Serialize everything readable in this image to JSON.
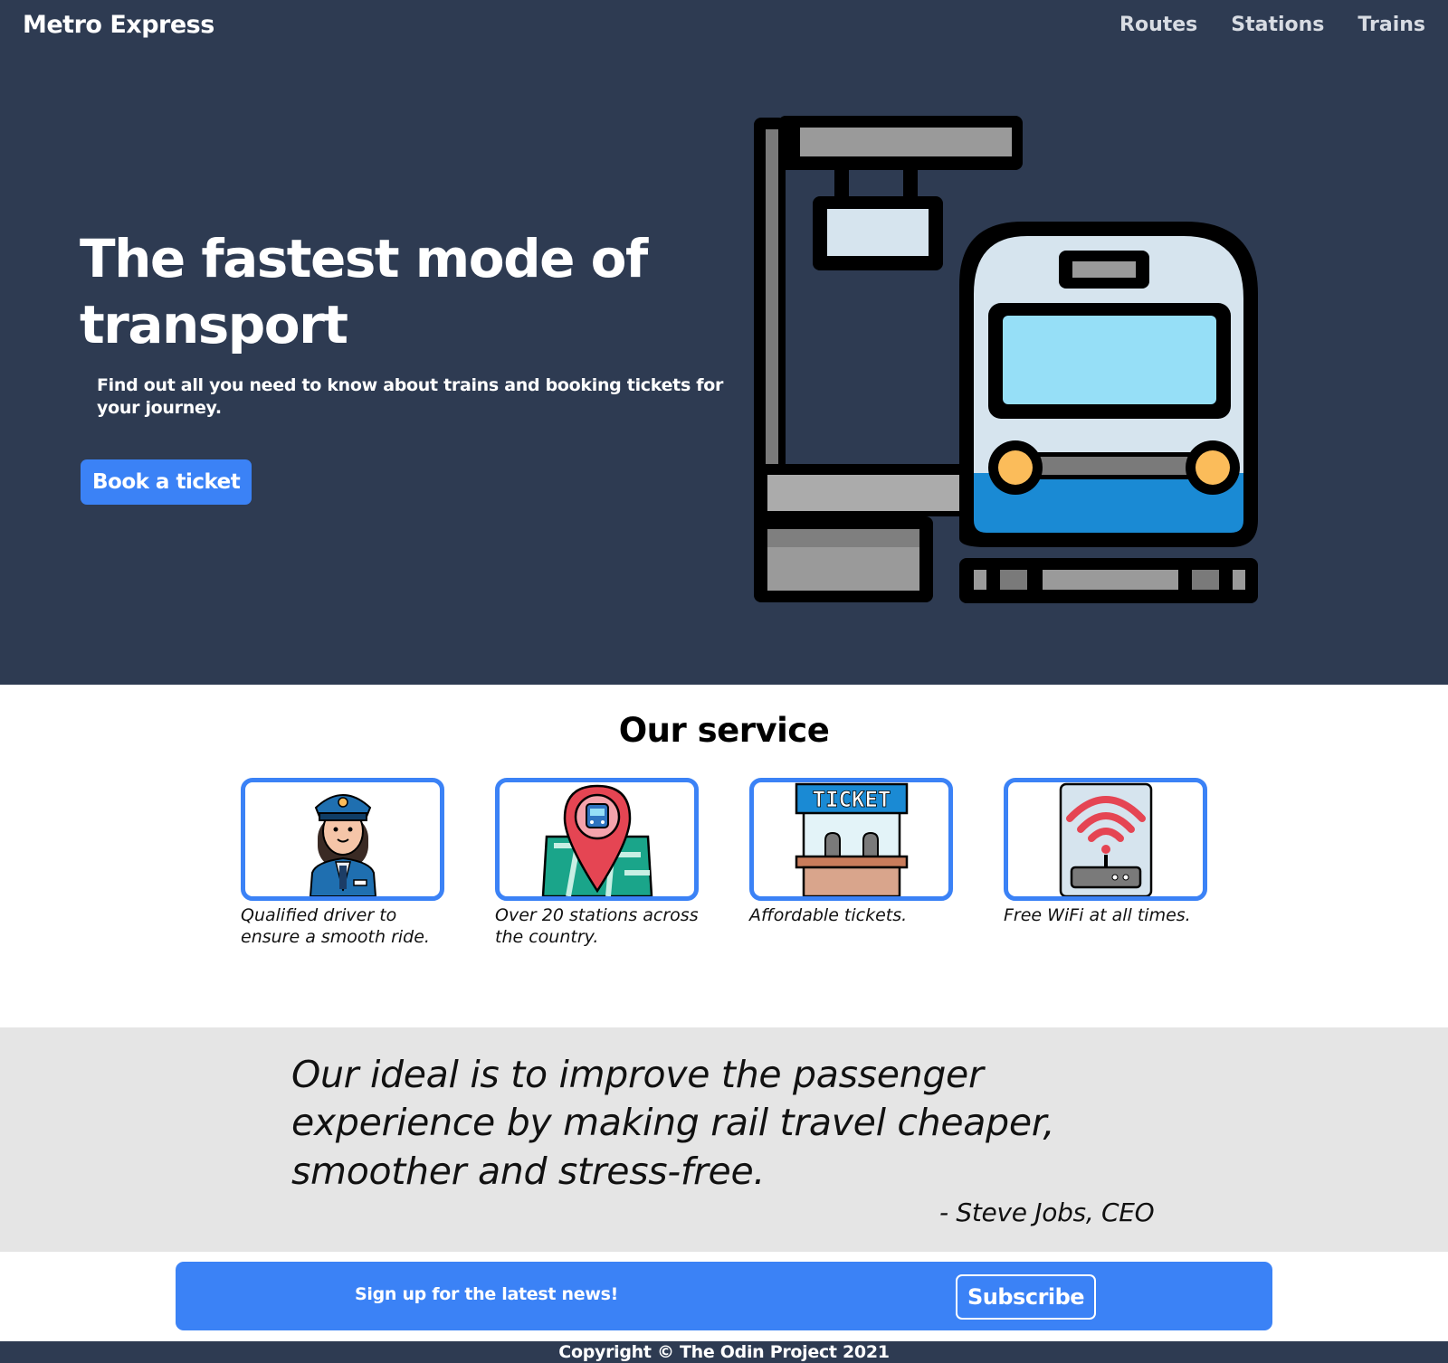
{
  "header": {
    "logo": "Metro Express",
    "nav": [
      "Routes",
      "Stations",
      "Trains"
    ]
  },
  "hero": {
    "title": "The fastest mode of transport",
    "subtitle": "Find out all you need to know about trains and booking tickets for your journey.",
    "button": "Book a ticket",
    "illustration": "train-station-icon"
  },
  "services": {
    "title": "Our service",
    "items": [
      {
        "icon": "train-conductor-icon",
        "text": "Qualified driver to ensure a smooth ride."
      },
      {
        "icon": "map-pin-train-icon",
        "text": "Over 20 stations across the country."
      },
      {
        "icon": "ticket-booth-icon",
        "text": "Affordable tickets."
      },
      {
        "icon": "wifi-router-icon",
        "text": "Free WiFi at all times."
      }
    ]
  },
  "quote": {
    "text": "Our ideal is to improve the passenger experience by making rail travel cheaper, smoother and stress-free.",
    "author": "- Steve Jobs, CEO"
  },
  "signup": {
    "text": "Sign up for the latest news!",
    "button": "Subscribe"
  },
  "footer": {
    "text": "Copyright © The Odin Project 2021"
  },
  "colors": {
    "dark": "#2e3b52",
    "accent": "#3b82f6",
    "quote_bg": "#e5e5e5"
  }
}
